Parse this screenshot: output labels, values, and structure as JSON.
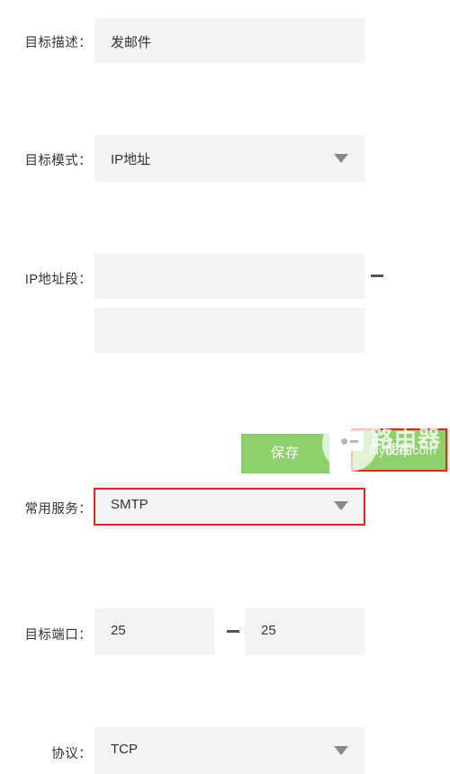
{
  "form": {
    "rows": [
      {
        "id": "target-description",
        "label": "目标描述：",
        "type": "text",
        "value": "发邮件",
        "placeholder": ""
      },
      {
        "id": "target-mode",
        "label": "目标模式：",
        "type": "select",
        "value": "IP地址",
        "caret": "chevron-down-icon"
      },
      {
        "id": "ip-range",
        "label": "IP地址段：",
        "type": "range-text",
        "start_value": "",
        "end_value": "",
        "separator": "—"
      },
      {
        "id": "common-service",
        "label": "常用服务：",
        "type": "select",
        "value": "SMTP",
        "caret": "chevron-down-icon",
        "highlighted": true
      },
      {
        "id": "target-port",
        "label": "目标端口：",
        "type": "range-number",
        "start_value": "25",
        "end_value": "25",
        "separator": "—"
      },
      {
        "id": "protocol",
        "label": "协议：",
        "type": "select",
        "value": "TCP",
        "caret": "chevron-down-icon"
      }
    ]
  },
  "actions": {
    "save_label": "保存",
    "secondary_label": "使用",
    "secondary_highlighted": true
  },
  "watermark": {
    "brand_cn": "路由器",
    "url": "luyouqi.com",
    "logo": "camera-logo-icon"
  },
  "colors": {
    "field_bg": "#f3f3f3",
    "label_text": "#333333",
    "value_text": "#333333",
    "caret": "#888888",
    "highlight_border": "#ff1a1a",
    "button_green": "#8ed16a",
    "button_text": "#ffffff",
    "page_bg": "#ffffff"
  }
}
